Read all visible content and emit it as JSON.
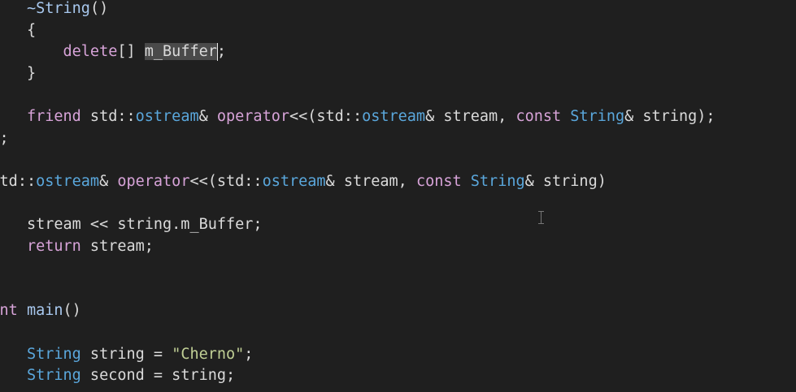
{
  "editor": {
    "lines": [
      [
        {
          "t": "    "
        },
        {
          "t": "~String",
          "c": "fn"
        },
        {
          "t": "()"
        }
      ],
      [
        {
          "t": "    {"
        }
      ],
      [
        {
          "t": "        "
        },
        {
          "t": "delete",
          "c": "kw"
        },
        {
          "t": "[] "
        },
        {
          "t": "m_Buffer",
          "c": "sel",
          "caret": true
        },
        {
          "t": ";"
        }
      ],
      [
        {
          "t": "    }"
        }
      ],
      [],
      [
        {
          "t": "    "
        },
        {
          "t": "friend",
          "c": "kw"
        },
        {
          "t": " std::"
        },
        {
          "t": "ostream",
          "c": "type"
        },
        {
          "t": "& "
        },
        {
          "t": "operator",
          "c": "kw"
        },
        {
          "t": "<<(std::"
        },
        {
          "t": "ostream",
          "c": "type"
        },
        {
          "t": "& stream, "
        },
        {
          "t": "const",
          "c": "kw"
        },
        {
          "t": " "
        },
        {
          "t": "String",
          "c": "type"
        },
        {
          "t": "& string);"
        }
      ],
      [
        {
          "t": "};"
        }
      ],
      [],
      [
        {
          "t": "std::"
        },
        {
          "t": "ostream",
          "c": "type"
        },
        {
          "t": "& "
        },
        {
          "t": "operator",
          "c": "kw"
        },
        {
          "t": "<<(std::"
        },
        {
          "t": "ostream",
          "c": "type"
        },
        {
          "t": "& stream, "
        },
        {
          "t": "const",
          "c": "kw"
        },
        {
          "t": " "
        },
        {
          "t": "String",
          "c": "type"
        },
        {
          "t": "& string)"
        }
      ],
      [],
      [
        {
          "t": "    stream << string.m_Buffer;"
        }
      ],
      [
        {
          "t": "    "
        },
        {
          "t": "return",
          "c": "kw"
        },
        {
          "t": " stream;"
        }
      ],
      [],
      [],
      [
        {
          "t": "int",
          "c": "kw"
        },
        {
          "t": " "
        },
        {
          "t": "main",
          "c": "fn"
        },
        {
          "t": "()"
        }
      ],
      [],
      [
        {
          "t": "    "
        },
        {
          "t": "String",
          "c": "type"
        },
        {
          "t": " string = "
        },
        {
          "t": "\"Cherno\"",
          "c": "str"
        },
        {
          "t": ";"
        }
      ],
      [
        {
          "t": "    "
        },
        {
          "t": "String",
          "c": "type"
        },
        {
          "t": " second = string;"
        }
      ]
    ]
  }
}
